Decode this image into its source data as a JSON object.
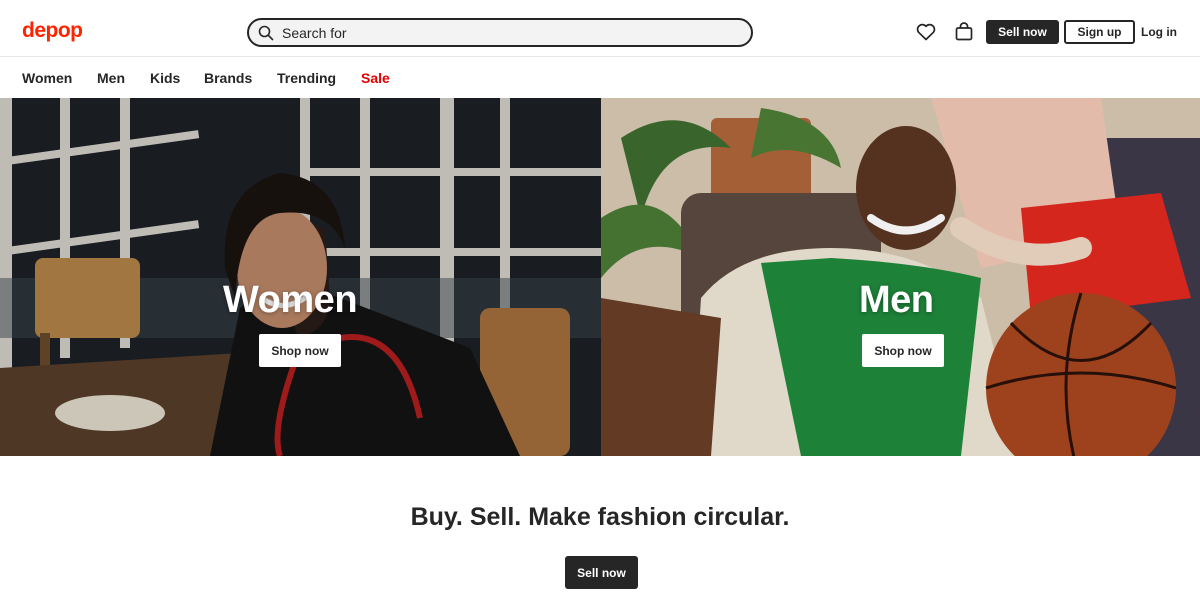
{
  "brand": {
    "logo_text": "depop",
    "accent_color": "#ff2300"
  },
  "search": {
    "placeholder": "Search for",
    "value": "",
    "icon": "search-icon"
  },
  "header": {
    "icons": [
      "heart-icon",
      "bag-icon"
    ],
    "sell_label": "Sell now",
    "signup_label": "Sign up",
    "login_label": "Log in"
  },
  "nav": {
    "items": [
      {
        "label": "Women"
      },
      {
        "label": "Men"
      },
      {
        "label": "Kids"
      },
      {
        "label": "Brands"
      },
      {
        "label": "Trending"
      },
      {
        "label": "Sale",
        "color": "#e60000"
      }
    ]
  },
  "hero": {
    "women": {
      "title": "Women",
      "button": "Shop now"
    },
    "men": {
      "title": "Men",
      "button": "Shop now"
    }
  },
  "footer_cta": {
    "tagline": "Buy. Sell. Make fashion circular.",
    "button": "Sell now"
  }
}
